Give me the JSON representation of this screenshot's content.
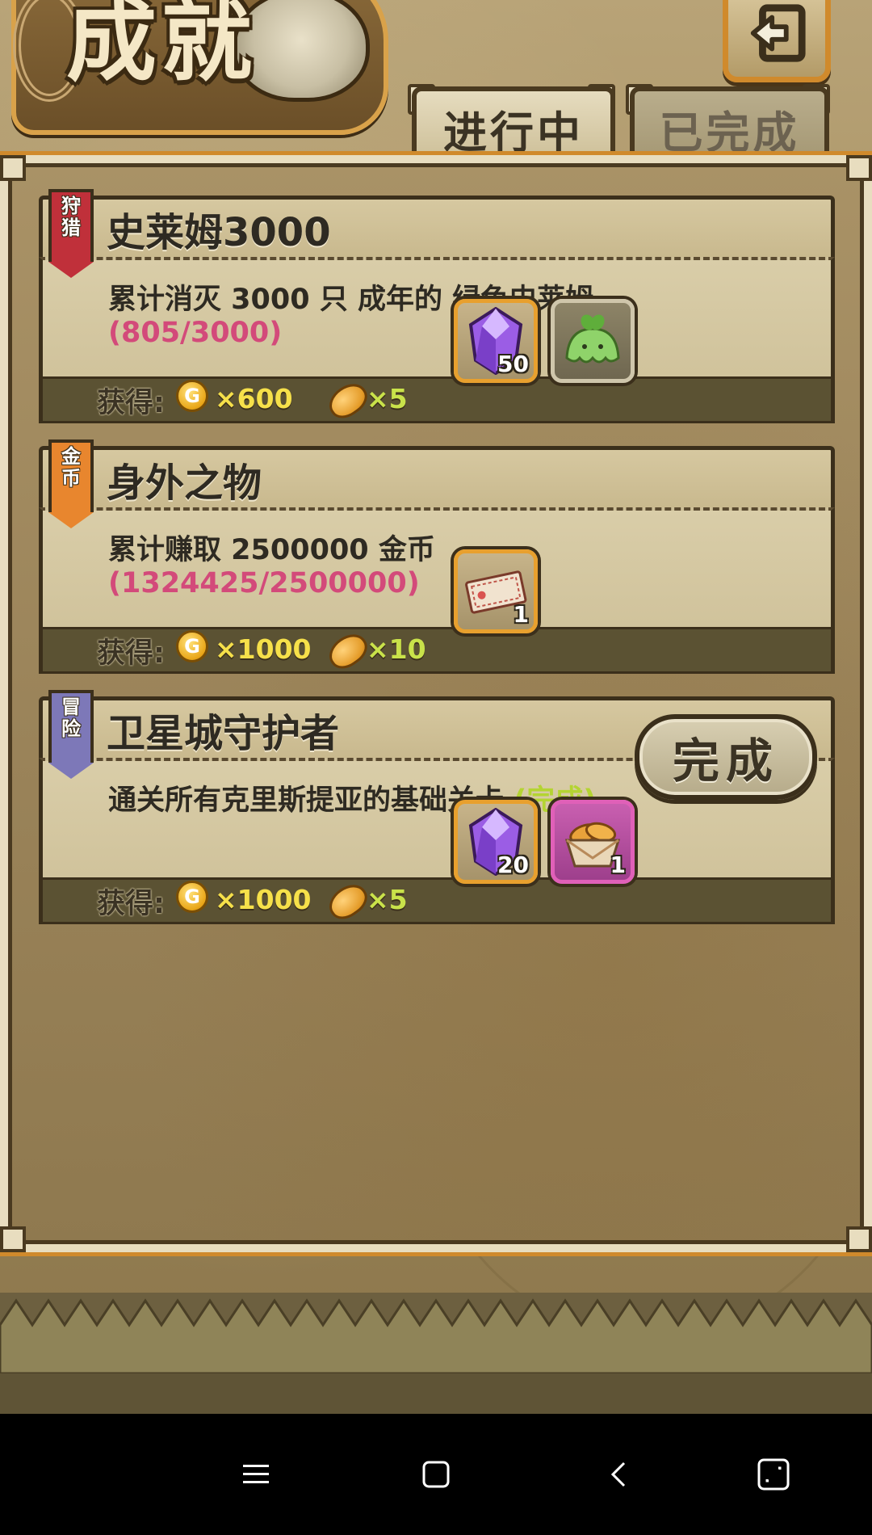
{
  "header": {
    "title": "成就"
  },
  "tabs": [
    {
      "label": "进行中",
      "active": true
    },
    {
      "label": "已完成",
      "active": false
    }
  ],
  "achievements": [
    {
      "badge": [
        "狩",
        "猎"
      ],
      "badge_color": "#c0303a",
      "title": "史莱姆3000",
      "description": "累计消灭 3000 只 成年的 绿色史莱姆",
      "progress": "(805/3000)",
      "reward_label": "获得:",
      "coin_icon": "G",
      "coin_reward": "×600",
      "bread_reward": "×5",
      "items": [
        {
          "icon": "purple-gem-icon",
          "qty": "50"
        },
        {
          "icon": "green-slime-icon",
          "qty": ""
        }
      ]
    },
    {
      "badge": [
        "金",
        "币"
      ],
      "badge_color": "#e8862e",
      "title": "身外之物",
      "description": "累计赚取 2500000 金币",
      "progress": "(1324425/2500000)",
      "reward_label": "获得:",
      "coin_icon": "G",
      "coin_reward": "×1000",
      "bread_reward": "×10",
      "items": [
        {
          "icon": "ticket-icon",
          "qty": "1"
        }
      ]
    },
    {
      "badge": [
        "冒",
        "险"
      ],
      "badge_color": "#7d78b8",
      "title": "卫星城守护者",
      "description": "通关所有克里斯提亚的基础关卡",
      "status": "(完成)",
      "reward_label": "获得:",
      "coin_icon": "G",
      "coin_reward": "×1000",
      "bread_reward": "×5",
      "complete_button": "完成",
      "items": [
        {
          "icon": "purple-gem-icon",
          "qty": "20"
        },
        {
          "icon": "bread-basket-icon",
          "qty": "1"
        }
      ]
    }
  ],
  "colors": {
    "progress": "#d34a7a",
    "coin_text": "#f6e04a",
    "bread_text": "#c9e24a",
    "done_text": "#b4d432",
    "frame_accent": "#d08a2c"
  },
  "nav_bar": [
    "menu-icon",
    "home-square-icon",
    "back-chevron-icon",
    "recents-icon"
  ]
}
